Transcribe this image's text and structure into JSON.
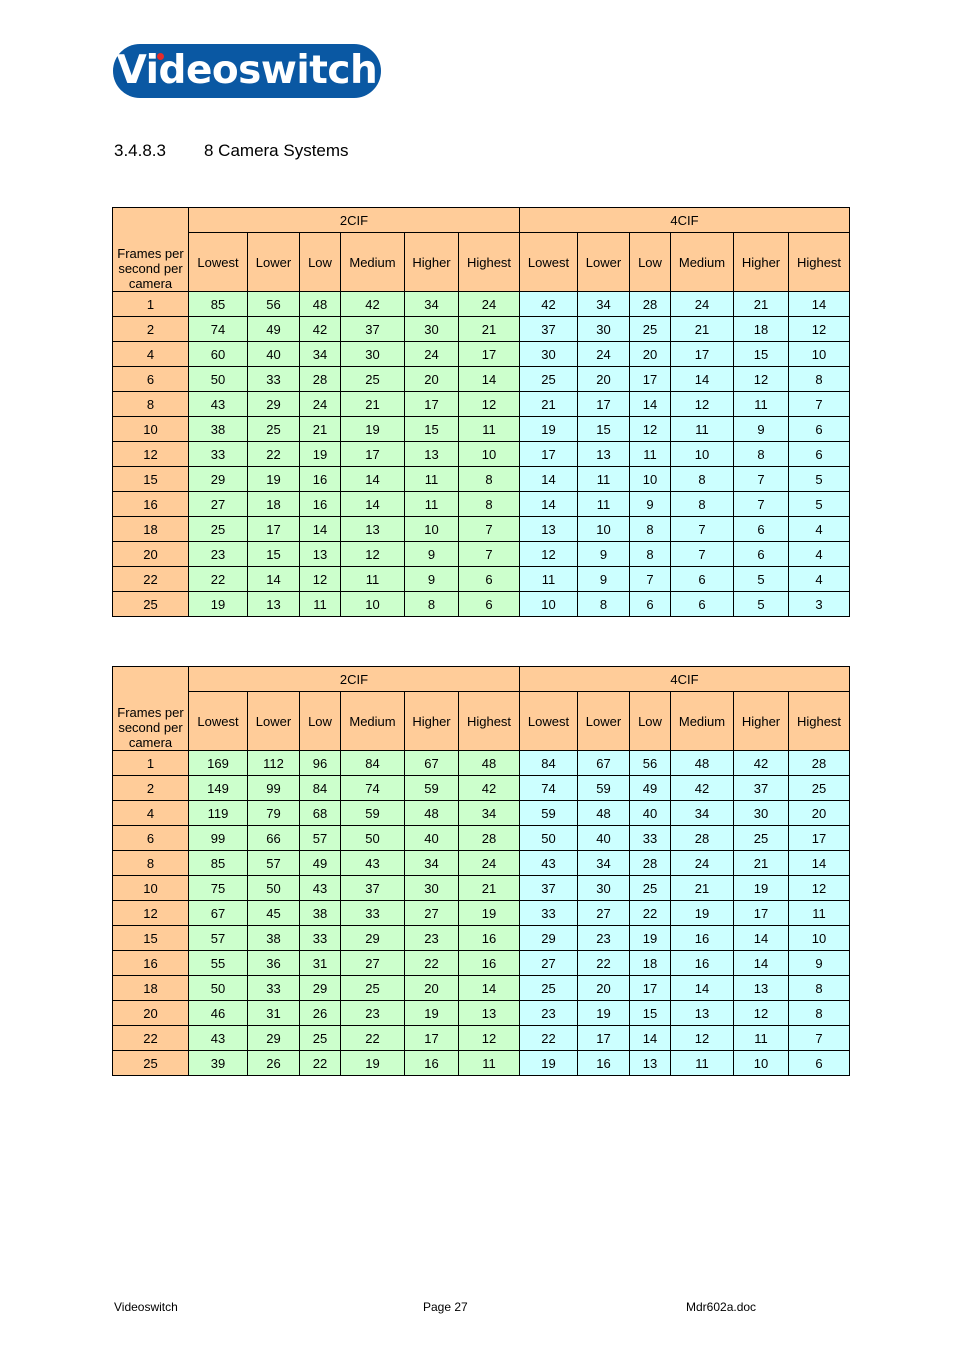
{
  "logo": {
    "text": "Videoswitch",
    "dot_color": "#e52b2b",
    "bg_color": "#0a58a3"
  },
  "heading": {
    "number": "3.4.8.3",
    "title": "8 Camera Systems"
  },
  "colors": {
    "header": "#ffcc99",
    "cif2_cells": "#ccffcc",
    "cif4_cells": "#ccffff"
  },
  "tables": [
    {
      "fps_header": "Frames per second per camera",
      "groups": [
        "2CIF",
        "4CIF"
      ],
      "quality_levels": [
        "Lowest",
        "Lower",
        "Low",
        "Medium",
        "Higher",
        "Highest"
      ],
      "rows": [
        {
          "fps": "1",
          "cif2": [
            "85",
            "56",
            "48",
            "42",
            "34",
            "24"
          ],
          "cif4": [
            "42",
            "34",
            "28",
            "24",
            "21",
            "14"
          ]
        },
        {
          "fps": "2",
          "cif2": [
            "74",
            "49",
            "42",
            "37",
            "30",
            "21"
          ],
          "cif4": [
            "37",
            "30",
            "25",
            "21",
            "18",
            "12"
          ]
        },
        {
          "fps": "4",
          "cif2": [
            "60",
            "40",
            "34",
            "30",
            "24",
            "17"
          ],
          "cif4": [
            "30",
            "24",
            "20",
            "17",
            "15",
            "10"
          ]
        },
        {
          "fps": "6",
          "cif2": [
            "50",
            "33",
            "28",
            "25",
            "20",
            "14"
          ],
          "cif4": [
            "25",
            "20",
            "17",
            "14",
            "12",
            "8"
          ]
        },
        {
          "fps": "8",
          "cif2": [
            "43",
            "29",
            "24",
            "21",
            "17",
            "12"
          ],
          "cif4": [
            "21",
            "17",
            "14",
            "12",
            "11",
            "7"
          ]
        },
        {
          "fps": "10",
          "cif2": [
            "38",
            "25",
            "21",
            "19",
            "15",
            "11"
          ],
          "cif4": [
            "19",
            "15",
            "12",
            "11",
            "9",
            "6"
          ]
        },
        {
          "fps": "12",
          "cif2": [
            "33",
            "22",
            "19",
            "17",
            "13",
            "10"
          ],
          "cif4": [
            "17",
            "13",
            "11",
            "10",
            "8",
            "6"
          ]
        },
        {
          "fps": "15",
          "cif2": [
            "29",
            "19",
            "16",
            "14",
            "11",
            "8"
          ],
          "cif4": [
            "14",
            "11",
            "10",
            "8",
            "7",
            "5"
          ]
        },
        {
          "fps": "16",
          "cif2": [
            "27",
            "18",
            "16",
            "14",
            "11",
            "8"
          ],
          "cif4": [
            "14",
            "11",
            "9",
            "8",
            "7",
            "5"
          ]
        },
        {
          "fps": "18",
          "cif2": [
            "25",
            "17",
            "14",
            "13",
            "10",
            "7"
          ],
          "cif4": [
            "13",
            "10",
            "8",
            "7",
            "6",
            "4"
          ]
        },
        {
          "fps": "20",
          "cif2": [
            "23",
            "15",
            "13",
            "12",
            "9",
            "7"
          ],
          "cif4": [
            "12",
            "9",
            "8",
            "7",
            "6",
            "4"
          ]
        },
        {
          "fps": "22",
          "cif2": [
            "22",
            "14",
            "12",
            "11",
            "9",
            "6"
          ],
          "cif4": [
            "11",
            "9",
            "7",
            "6",
            "5",
            "4"
          ]
        },
        {
          "fps": "25",
          "cif2": [
            "19",
            "13",
            "11",
            "10",
            "8",
            "6"
          ],
          "cif4": [
            "10",
            "8",
            "6",
            "6",
            "5",
            "3"
          ]
        }
      ]
    },
    {
      "fps_header": "Frames per second per camera",
      "groups": [
        "2CIF",
        "4CIF"
      ],
      "quality_levels": [
        "Lowest",
        "Lower",
        "Low",
        "Medium",
        "Higher",
        "Highest"
      ],
      "rows": [
        {
          "fps": "1",
          "cif2": [
            "169",
            "112",
            "96",
            "84",
            "67",
            "48"
          ],
          "cif4": [
            "84",
            "67",
            "56",
            "48",
            "42",
            "28"
          ]
        },
        {
          "fps": "2",
          "cif2": [
            "149",
            "99",
            "84",
            "74",
            "59",
            "42"
          ],
          "cif4": [
            "74",
            "59",
            "49",
            "42",
            "37",
            "25"
          ]
        },
        {
          "fps": "4",
          "cif2": [
            "119",
            "79",
            "68",
            "59",
            "48",
            "34"
          ],
          "cif4": [
            "59",
            "48",
            "40",
            "34",
            "30",
            "20"
          ]
        },
        {
          "fps": "6",
          "cif2": [
            "99",
            "66",
            "57",
            "50",
            "40",
            "28"
          ],
          "cif4": [
            "50",
            "40",
            "33",
            "28",
            "25",
            "17"
          ]
        },
        {
          "fps": "8",
          "cif2": [
            "85",
            "57",
            "49",
            "43",
            "34",
            "24"
          ],
          "cif4": [
            "43",
            "34",
            "28",
            "24",
            "21",
            "14"
          ]
        },
        {
          "fps": "10",
          "cif2": [
            "75",
            "50",
            "43",
            "37",
            "30",
            "21"
          ],
          "cif4": [
            "37",
            "30",
            "25",
            "21",
            "19",
            "12"
          ]
        },
        {
          "fps": "12",
          "cif2": [
            "67",
            "45",
            "38",
            "33",
            "27",
            "19"
          ],
          "cif4": [
            "33",
            "27",
            "22",
            "19",
            "17",
            "11"
          ]
        },
        {
          "fps": "15",
          "cif2": [
            "57",
            "38",
            "33",
            "29",
            "23",
            "16"
          ],
          "cif4": [
            "29",
            "23",
            "19",
            "16",
            "14",
            "10"
          ]
        },
        {
          "fps": "16",
          "cif2": [
            "55",
            "36",
            "31",
            "27",
            "22",
            "16"
          ],
          "cif4": [
            "27",
            "22",
            "18",
            "16",
            "14",
            "9"
          ]
        },
        {
          "fps": "18",
          "cif2": [
            "50",
            "33",
            "29",
            "25",
            "20",
            "14"
          ],
          "cif4": [
            "25",
            "20",
            "17",
            "14",
            "13",
            "8"
          ]
        },
        {
          "fps": "20",
          "cif2": [
            "46",
            "31",
            "26",
            "23",
            "19",
            "13"
          ],
          "cif4": [
            "23",
            "19",
            "15",
            "13",
            "12",
            "8"
          ]
        },
        {
          "fps": "22",
          "cif2": [
            "43",
            "29",
            "25",
            "22",
            "17",
            "12"
          ],
          "cif4": [
            "22",
            "17",
            "14",
            "12",
            "11",
            "7"
          ]
        },
        {
          "fps": "25",
          "cif2": [
            "39",
            "26",
            "22",
            "19",
            "16",
            "11"
          ],
          "cif4": [
            "19",
            "16",
            "13",
            "11",
            "10",
            "6"
          ]
        }
      ]
    }
  ],
  "footer": {
    "left": "Videoswitch",
    "center": "Page 27",
    "right": "Mdr602a.doc"
  }
}
